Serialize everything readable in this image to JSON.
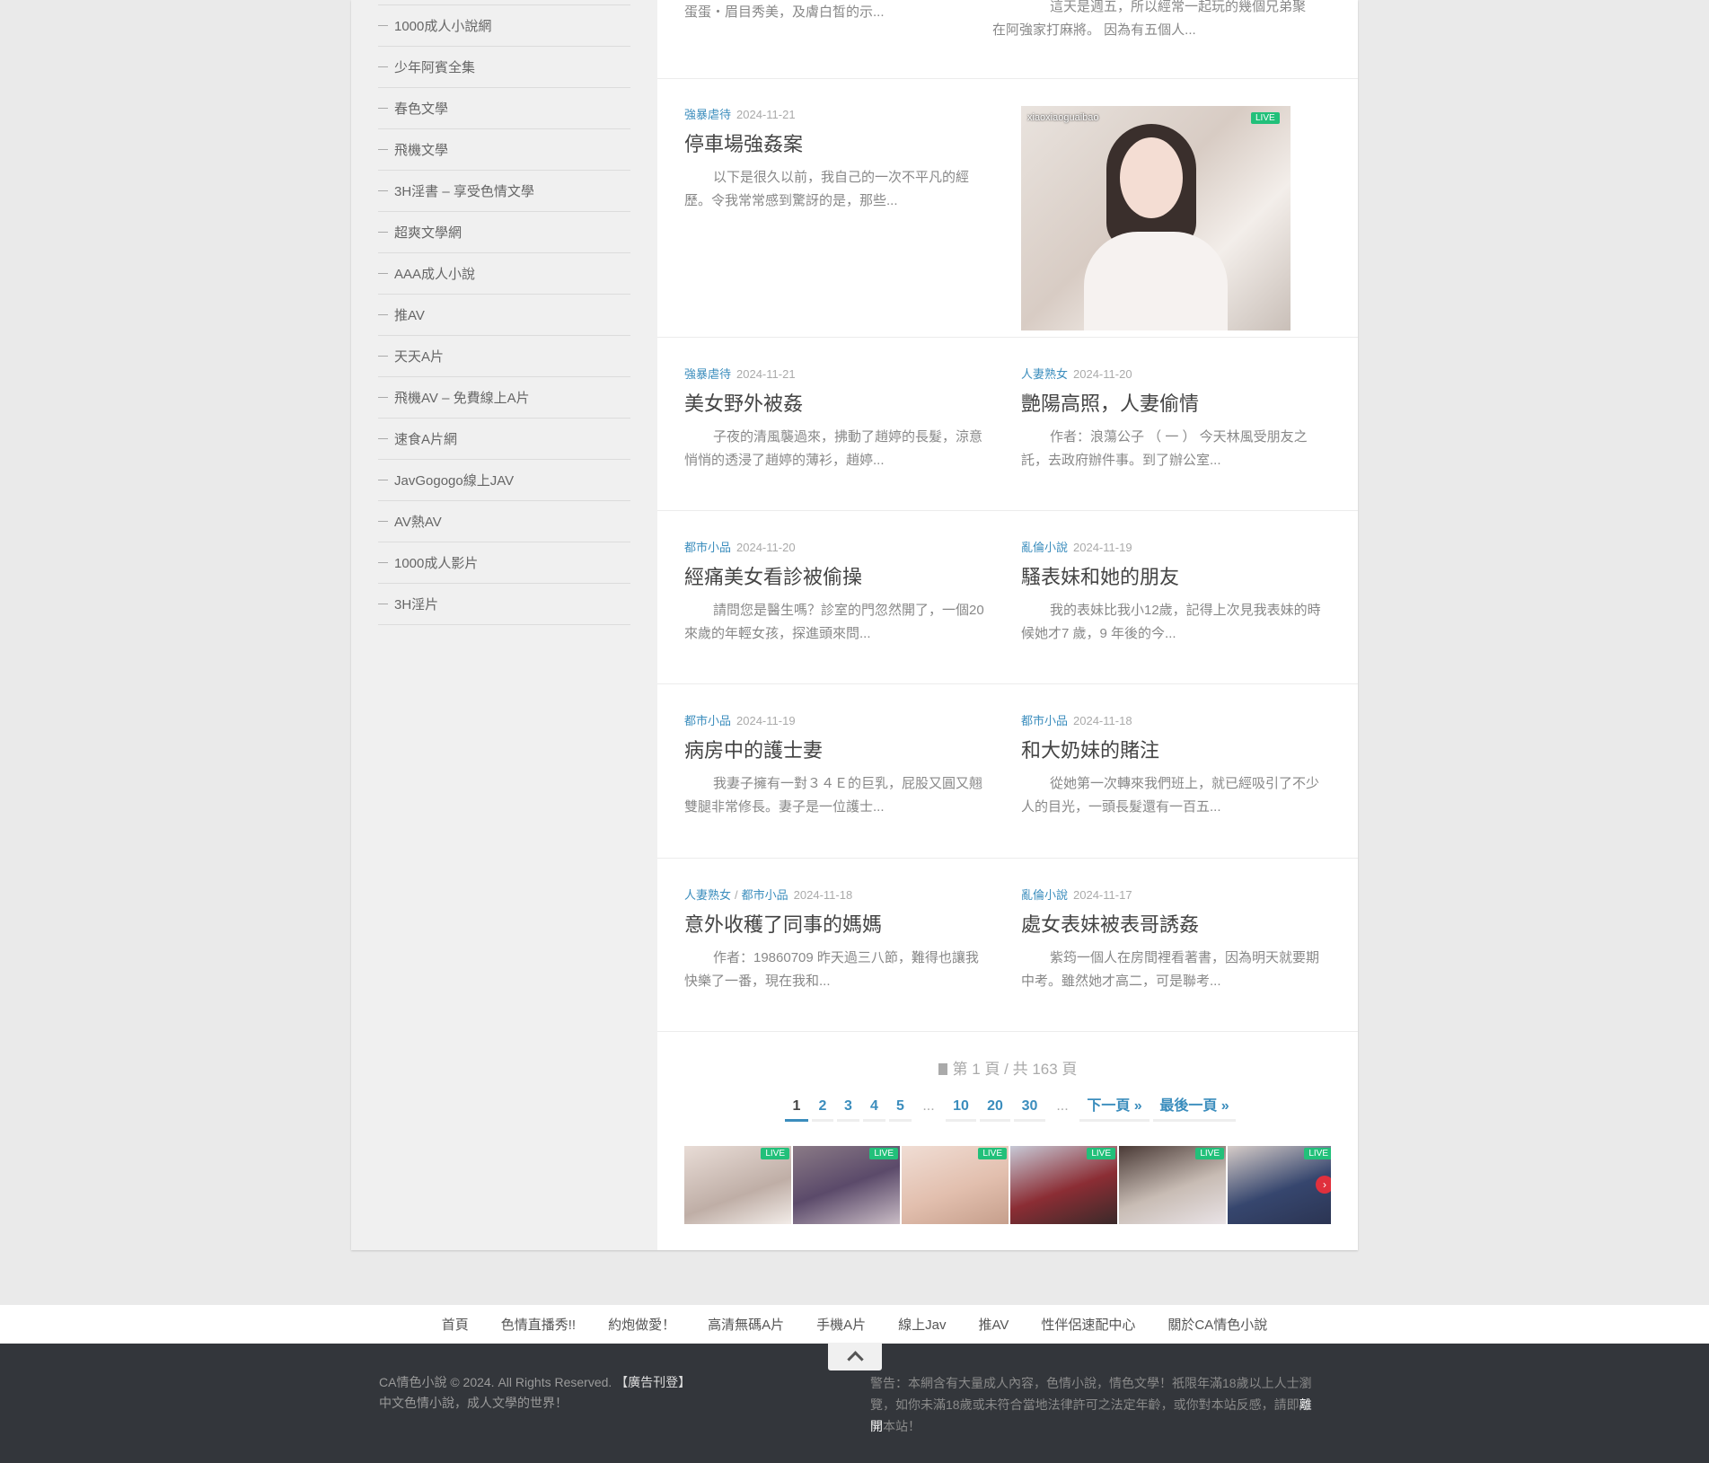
{
  "sidebar": {
    "links": [
      "1000成人小說網",
      "少年阿賓全集",
      "春色文學",
      "飛機文學",
      "3H淫書 – 享受色情文學",
      "超爽文學網",
      "AAA成人小說",
      "推AV",
      "天天A片",
      "飛機AV – 免費線上A片",
      "速食A片網",
      "JavGogogo線上JAV",
      "AV熱AV",
      "1000成人影片",
      "3H淫片"
    ]
  },
  "top_fragments": {
    "left": "蛋蛋・眉目秀美，及膚白皙的示...",
    "right_line1": "這天是週五，所以經常一起玩的幾個兄弟聚",
    "right_line2": "在阿強家打麻將。 因為有五個人..."
  },
  "posts": [
    {
      "cats": [
        "強暴虐待"
      ],
      "date": "2024-11-21",
      "title": "停車場強姦案",
      "excerpt": "以下是很久以前，我自己的一次不平凡的經歷。令我常常感到驚訝的是，那些..."
    },
    {
      "cats": [
        "強暴虐待"
      ],
      "date": "2024-11-21",
      "title": "美女野外被姦",
      "excerpt": "子夜的清風襲過來，拂動了趙婷的長髮，涼意悄悄的透浸了趙婷的薄衫，趙婷..."
    },
    {
      "cats": [
        "人妻熟女"
      ],
      "date": "2024-11-20",
      "title": "艷陽高照，人妻偷情",
      "excerpt": "作者：浪蕩公子 （ 一 ） 今天林風受朋友之託，去政府辦件事。到了辦公室..."
    },
    {
      "cats": [
        "都市小品"
      ],
      "date": "2024-11-20",
      "title": "經痛美女看診被偷操",
      "excerpt": "請問您是醫生嗎？診室的門忽然開了，一個20來歲的年輕女孩，探進頭來問..."
    },
    {
      "cats": [
        "亂倫小說"
      ],
      "date": "2024-11-19",
      "title": "騷表妹和她的朋友",
      "excerpt": "我的表妹比我小12歲，記得上次見我表妹的時候她才7 歲，9 年後的今..."
    },
    {
      "cats": [
        "都市小品"
      ],
      "date": "2024-11-19",
      "title": "病房中的護士妻",
      "excerpt": "我妻子擁有一對３４Ｅ的巨乳，屁股又圓又翹雙腿非常修長。妻子是一位護士..."
    },
    {
      "cats": [
        "都市小品"
      ],
      "date": "2024-11-18",
      "title": "和大奶妹的賭注",
      "excerpt": "從她第一次轉來我們班上，就已經吸引了不少人的目光，一頭長髮還有一百五..."
    },
    {
      "cats": [
        "人妻熟女",
        "都市小品"
      ],
      "date": "2024-11-18",
      "title": "意外收穫了同事的媽媽",
      "excerpt": "作者：19860709 昨天過三八節，難得也讓我快樂了一番，現在我和..."
    },
    {
      "cats": [
        "亂倫小說"
      ],
      "date": "2024-11-17",
      "title": "處女表妹被表哥誘姦",
      "excerpt": "紫筠一個人在房間裡看著書，因為明天就要期中考。雖然她才高二，可是聯考..."
    }
  ],
  "ad": {
    "username": "xiaoxiaoguaibao",
    "live_label": "LIVE"
  },
  "pagination": {
    "info": "第 1 頁 / 共 163 頁",
    "pages": [
      "1",
      "2",
      "3",
      "4",
      "5",
      "...",
      "10",
      "20",
      "30",
      "...",
      "下一頁 »",
      "最後一頁 »"
    ]
  },
  "footer_nav": [
    "首頁",
    "色情直播秀!!",
    "約炮做愛！",
    "高清無碼A片",
    "手機A片",
    "線上Jav",
    "推AV",
    "性伴侶速配中心",
    "關於CA情色小說"
  ],
  "copyright": {
    "line1": "CA情色小說 © 2024. All Rights Reserved.",
    "ad_link": "【廣告刊登】",
    "line2": "中文色情小說，成人文學的世界！"
  },
  "warning": {
    "text": "警告：本網含有大量成人內容，色情小說，情色文學！祇限年滿18歲以上人士瀏覽，如你未滿18歲或未符合當地法律許可之法定年齡，或你對本站反感，請即",
    "leave": "離開",
    "end": "本站！"
  },
  "colors": {
    "accent": "#3b8dbd",
    "live": "#22c07a",
    "footer_bg": "#33363b"
  }
}
